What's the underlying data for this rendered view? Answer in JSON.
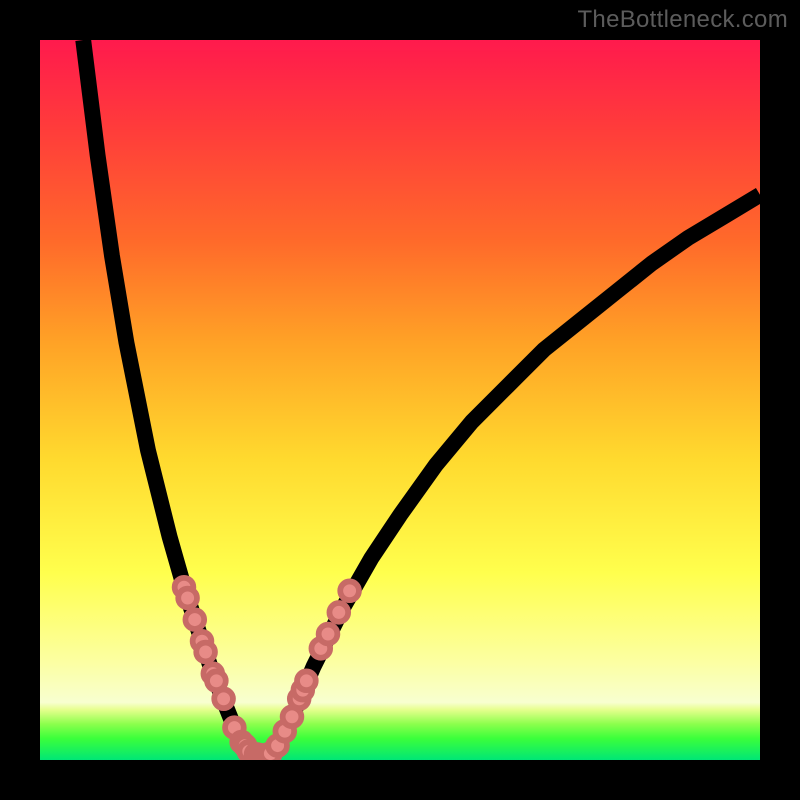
{
  "watermark": "TheBottleneck.com",
  "chart_data": {
    "type": "line",
    "title": "",
    "xlabel": "",
    "ylabel": "",
    "xlim": [
      0,
      100
    ],
    "ylim": [
      0,
      100
    ],
    "grid": false,
    "legend": false,
    "background_gradient": {
      "stops": [
        {
          "pos": 0,
          "color": "#ff1a4d"
        },
        {
          "pos": 12,
          "color": "#ff3b3b"
        },
        {
          "pos": 28,
          "color": "#ff6a2a"
        },
        {
          "pos": 42,
          "color": "#ffa226"
        },
        {
          "pos": 58,
          "color": "#ffd92e"
        },
        {
          "pos": 74,
          "color": "#ffff4d"
        },
        {
          "pos": 86,
          "color": "#fcff9f"
        },
        {
          "pos": 92,
          "color": "#f8ffd0"
        },
        {
          "pos": 93,
          "color": "#e6ff8e"
        },
        {
          "pos": 95,
          "color": "#8cff4d"
        },
        {
          "pos": 97,
          "color": "#3bff3b"
        },
        {
          "pos": 100,
          "color": "#00e676"
        }
      ]
    },
    "series": [
      {
        "name": "left-branch",
        "x": [
          6,
          7,
          8,
          9,
          10,
          11,
          12,
          13,
          14,
          15,
          16,
          17,
          18,
          19,
          20,
          21,
          22,
          23,
          24,
          25,
          26,
          27,
          28
        ],
        "y": [
          100,
          92,
          84,
          77,
          70,
          64,
          58,
          53,
          48,
          43,
          39,
          35,
          31,
          27.5,
          24,
          21,
          18,
          15,
          12,
          9.5,
          7,
          4.5,
          2.5
        ]
      },
      {
        "name": "valley",
        "x": [
          28,
          29,
          30,
          31,
          32,
          33
        ],
        "y": [
          2.5,
          1.2,
          0.7,
          0.6,
          0.9,
          2.0
        ]
      },
      {
        "name": "right-branch",
        "x": [
          33,
          35,
          38,
          42,
          46,
          50,
          55,
          60,
          65,
          70,
          75,
          80,
          85,
          90,
          95,
          100
        ],
        "y": [
          2.0,
          6,
          13,
          21,
          28,
          34,
          41,
          47,
          52,
          57,
          61,
          65,
          69,
          72.5,
          75.5,
          78.5
        ]
      }
    ],
    "markers": [
      {
        "x": 20,
        "y": 24
      },
      {
        "x": 20.5,
        "y": 22.5
      },
      {
        "x": 21.5,
        "y": 19.5
      },
      {
        "x": 22.5,
        "y": 16.5
      },
      {
        "x": 23,
        "y": 15
      },
      {
        "x": 24,
        "y": 12
      },
      {
        "x": 24.5,
        "y": 11
      },
      {
        "x": 25.5,
        "y": 8.5
      },
      {
        "x": 27,
        "y": 4.5
      },
      {
        "x": 28,
        "y": 2.5
      },
      {
        "x": 28.5,
        "y": 2
      },
      {
        "x": 29,
        "y": 1.2
      },
      {
        "x": 30,
        "y": 0.8
      },
      {
        "x": 30.5,
        "y": 0.7
      },
      {
        "x": 31,
        "y": 0.6
      },
      {
        "x": 31.5,
        "y": 0.7
      },
      {
        "x": 32,
        "y": 0.9
      },
      {
        "x": 33,
        "y": 2
      },
      {
        "x": 34,
        "y": 4
      },
      {
        "x": 35,
        "y": 6
      },
      {
        "x": 36,
        "y": 8.5
      },
      {
        "x": 36.5,
        "y": 9.7
      },
      {
        "x": 37,
        "y": 11
      },
      {
        "x": 39,
        "y": 15.5
      },
      {
        "x": 40,
        "y": 17.5
      },
      {
        "x": 41.5,
        "y": 20.5
      },
      {
        "x": 43,
        "y": 23.5
      }
    ],
    "marker_radius": 1.3
  }
}
